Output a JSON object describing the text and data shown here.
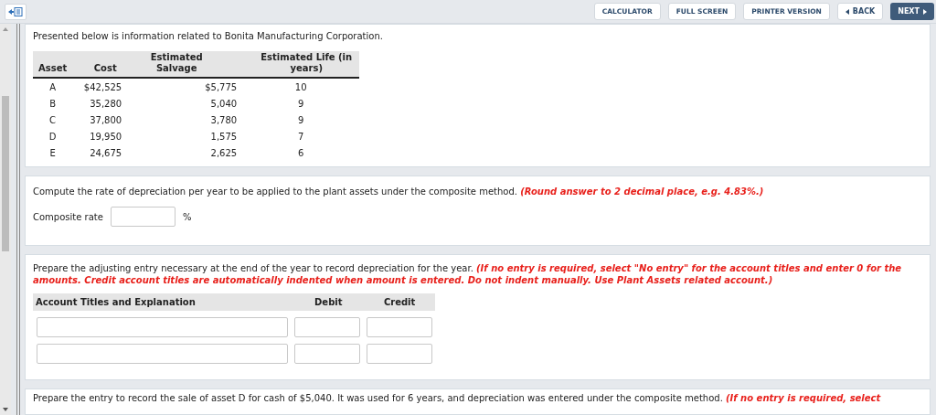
{
  "toolbar": {
    "buttons": [
      {
        "label": "CALCULATOR",
        "kind": "plain"
      },
      {
        "label": "FULL SCREEN",
        "kind": "plain"
      },
      {
        "label": "PRINTER VERSION",
        "kind": "plain"
      },
      {
        "label": "BACK",
        "kind": "back"
      },
      {
        "label": "NEXT",
        "kind": "next"
      }
    ]
  },
  "intro": {
    "text": "Presented below is information related to Bonita Manufacturing Corporation.",
    "table": {
      "columns": [
        "Asset",
        "Cost",
        "Estimated Salvage",
        "Estimated Life (in years)"
      ],
      "rows": [
        [
          "A",
          "$42,525",
          "$5,775",
          "10"
        ],
        [
          "B",
          "35,280",
          "5,040",
          "9"
        ],
        [
          "C",
          "37,800",
          "3,780",
          "9"
        ],
        [
          "D",
          "19,950",
          "1,575",
          "7"
        ],
        [
          "E",
          "24,675",
          "2,625",
          "6"
        ]
      ]
    }
  },
  "rate_question": {
    "text": "Compute the rate of depreciation per year to be applied to the plant assets under the composite method.",
    "note": "(Round answer to 2 decimal place, e.g. 4.83%.)",
    "field_label": "Composite rate",
    "unit": "%"
  },
  "entry_question": {
    "text": "Prepare the adjusting entry necessary at the end of the year to record depreciation for the year.",
    "note": "(If no entry is required, select \"No entry\" for the account titles and enter 0 for the amounts. Credit account titles are automatically indented when amount is entered. Do not indent manually. Use Plant Assets related account.)",
    "columns": [
      "Account Titles and Explanation",
      "Debit",
      "Credit"
    ],
    "rows": [
      {
        "kind": "entry"
      },
      {
        "kind": "entry"
      }
    ]
  },
  "sale_question": {
    "text": "Prepare the entry to record the sale of asset D for cash of $5,040. It was used for 6 years, and depreciation was entered under the composite method.",
    "note": "(If no entry is required, select"
  }
}
